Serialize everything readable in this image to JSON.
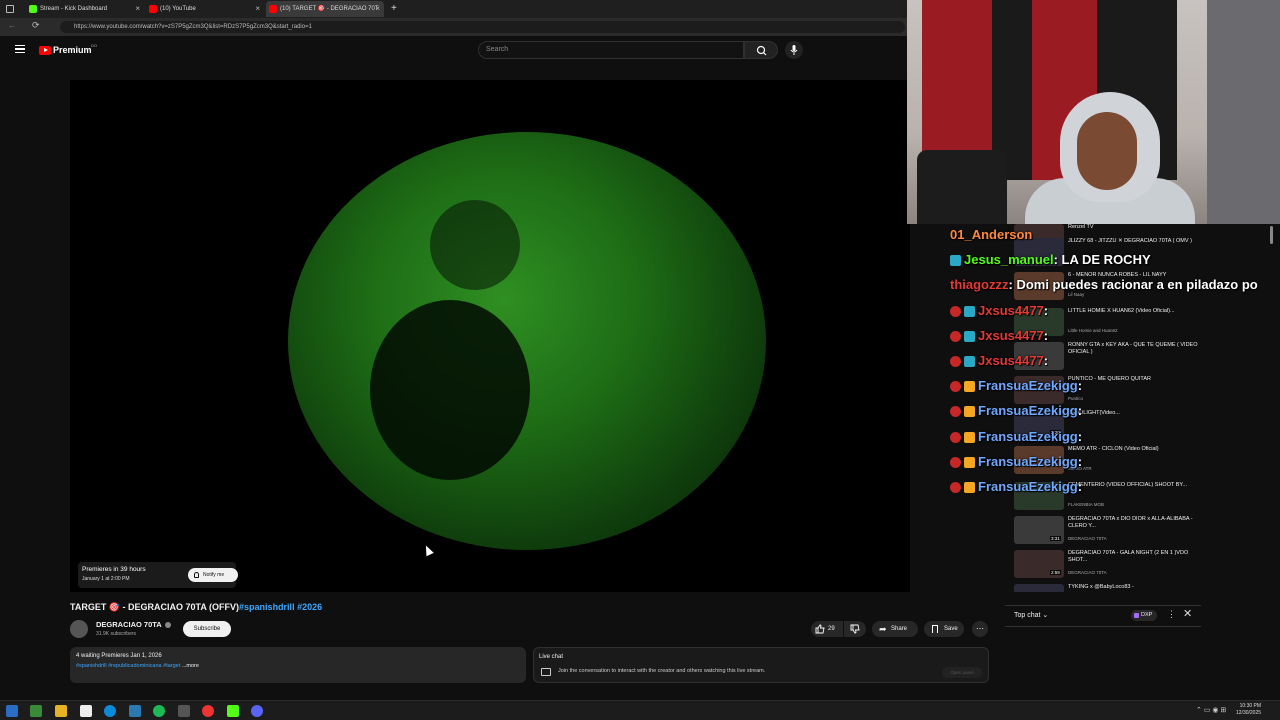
{
  "browser": {
    "tabs": [
      {
        "label": "Stream - Kick Dashboard",
        "icon_color": "#53fc18",
        "icon": "kick-icon"
      },
      {
        "label": "(10) YouTube",
        "icon_color": "#ff0000",
        "icon": "youtube-icon"
      },
      {
        "label": "(10) TARGET 🎯 - DEGRACIAO 70T",
        "icon_color": "#ff0000",
        "icon": "youtube-icon"
      }
    ],
    "url": "https://www.youtube.com/watch?v=zS7P5gZcm3Q&list=RDzS7P5gZcm3Q&start_radio=1"
  },
  "youtube": {
    "logo": "Premium",
    "logo_sup": "DO",
    "search_placeholder": "Search",
    "premiere": {
      "line1": "Premieres in 39 hours",
      "line2": "January 1 at 2:00 PM",
      "notify": "Notify me"
    },
    "video": {
      "title": "TARGET 🎯 - DEGRACIAO 70TA (OFFV)",
      "title_tags": "#spanishdrill #2026",
      "channel": "DEGRACIAO 70TA",
      "subscribers": "31.9K subscribers",
      "subscribe": "Subscribe",
      "likes": "29",
      "share": "Share",
      "save": "Save"
    },
    "description": {
      "line1": "4 waiting  Premieres Jan 1, 2026",
      "tags": "#spanishdrill #republicadominicana #target",
      "more": " ...more"
    },
    "live_chat": {
      "title": "Live chat",
      "text": "Join the conversation to interact with the creator and others watching this live stream.",
      "open": "Open panel"
    },
    "top_chat": {
      "label": "Top chat",
      "badge": "DXP"
    }
  },
  "stream_chat": [
    {
      "user": "01_Anderson",
      "message": "",
      "color": "#ff8a3d",
      "badge": ""
    },
    {
      "user": "Jesus_manuel",
      "message": ": LA DE ROCHY",
      "color": "#53fc18",
      "badge": "#2aa8c5"
    },
    {
      "user": "thiagozzz",
      "message": ": Domi puedes racionar a en piladazo po",
      "color": "#e53935",
      "badge": ""
    },
    {
      "user": "Jxsus4477",
      "message": ":",
      "color": "#e53935",
      "badge": "#2aa8c5"
    },
    {
      "user": "Jxsus4477",
      "message": ":",
      "color": "#e53935",
      "badge": "#2aa8c5"
    },
    {
      "user": "Jxsus4477",
      "message": ":",
      "color": "#e53935",
      "badge": "#2aa8c5"
    },
    {
      "user": "FransuaEzekigg",
      "message": ":",
      "color": "#6fa8ff",
      "badge": "#f5a623"
    },
    {
      "user": "FransuaEzekigg",
      "message": ":",
      "color": "#6fa8ff",
      "badge": "#f5a623"
    },
    {
      "user": "FransuaEzekigg",
      "message": ":",
      "color": "#6fa8ff",
      "badge": "#f5a623"
    },
    {
      "user": "FransuaEzekigg",
      "message": ":",
      "color": "#6fa8ff",
      "badge": "#f5a623"
    },
    {
      "user": "FransuaEzekigg",
      "message": ":",
      "color": "#6fa8ff",
      "badge": "#f5a623"
    }
  ],
  "recommended": [
    {
      "title": "Renzel TV",
      "channel": "",
      "duration": ""
    },
    {
      "title": "JLIZZY 68 - JITZZU ✕ DEGRACIAO 70TA ( OMV )",
      "channel": "",
      "duration": ""
    },
    {
      "title": "6 - MENOR NUNCA ROBES - LIL NAYY",
      "channel": "Lil Naay",
      "duration": ""
    },
    {
      "title": "LITTLE HOMIE X HUAN62 (Video Oficial)...",
      "channel": "Little Homie and Huan62",
      "duration": ""
    },
    {
      "title": "RONNY GTA x KEY AKA - QUE TE QUEME ( VIDEO OFICIAL )",
      "channel": "",
      "duration": ""
    },
    {
      "title": "PUNTICO - ME QUIERO QUITAR",
      "channel": "Puntico",
      "duration": ""
    },
    {
      "title": "DEADLIGHT(Video...",
      "channel": "",
      "duration": "2:20"
    },
    {
      "title": "MEMO ATR - CICLON (Video Oficial)",
      "channel": "MEMO ATR",
      "duration": ""
    },
    {
      "title": "CEMENTERIO (VIDEO OFFICIAL) SHOOT BY...",
      "channel": "FLAKENBIA MOB",
      "duration": ""
    },
    {
      "title": "DEGRACIAO 70TA x DIO DIOR x ALLA-ALIBABA - CLERO Y...",
      "channel": "DEGRACIAO 70TA",
      "duration": "3:31"
    },
    {
      "title": "DEGRACIAO 70TA - GALA NIGHT (2 EN 1 )VDO SHOT...",
      "channel": "DEGRACIAO 70TA",
      "duration": "2:59"
    },
    {
      "title": "TYKING x @BabyLoco83 -",
      "channel": "",
      "duration": ""
    }
  ],
  "taskbar": {
    "time": "10:30 PM",
    "date": "12/30/2025"
  },
  "colors": {
    "accent_link": "#3ea6ff",
    "background": "#0f0f0f",
    "youtube_red": "#ff0000",
    "kick_green": "#53fc18"
  }
}
